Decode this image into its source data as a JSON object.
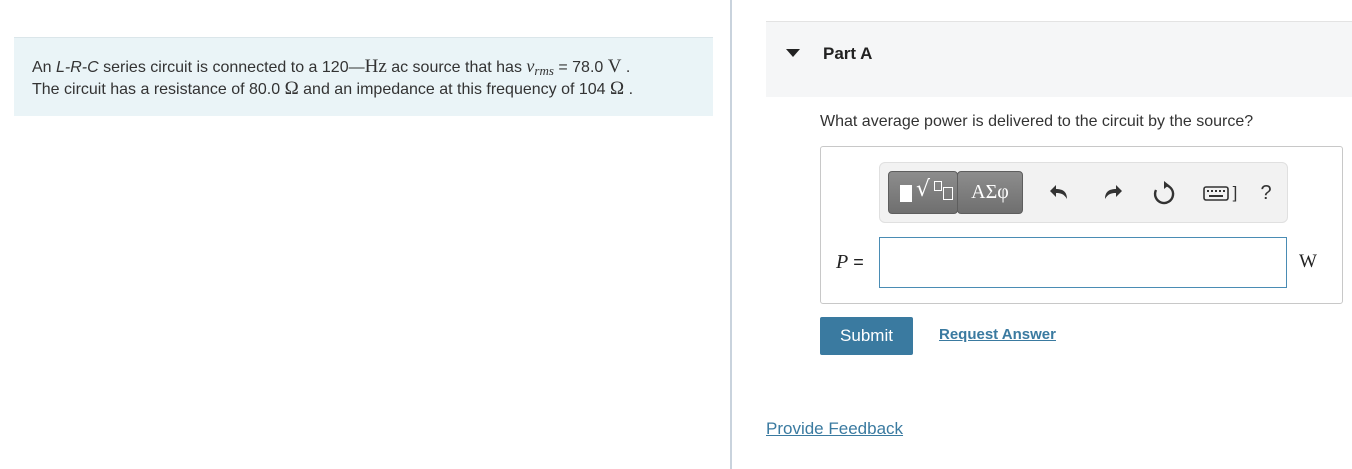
{
  "problem": {
    "line1_prefix": "An ",
    "circuit_type": "L-R-C",
    "line1_mid": " series circuit is connected to a 120",
    "dash": "—",
    "hz_unit": "Hz",
    "line1_mid2": " ac source that has ",
    "vrms_symbol": "v",
    "vrms_sub": "rms",
    "vrms_value": " = 78.0 ",
    "volt_unit": "V",
    "line1_end": " .",
    "line2_prefix": "The circuit has a resistance of 80.0 ",
    "ohm1": "Ω",
    "line2_mid": " and an impedance at this frequency of 104 ",
    "ohm2": "Ω",
    "line2_end": " ."
  },
  "part": {
    "title": "Part A",
    "question": "What average power is delivered to the circuit by the source?"
  },
  "toolbar": {
    "templates_icon": "templates-icon",
    "symbols_label": "ΑΣφ",
    "undo_icon": "undo-icon",
    "redo_icon": "redo-icon",
    "reset_icon": "reset-icon",
    "keyboard_icon": "keyboard-icon",
    "keyboard_bracket": "]",
    "help_label": "?"
  },
  "answer": {
    "variable": "P",
    "equals": " =",
    "value": "",
    "unit": "W"
  },
  "actions": {
    "submit_label": "Submit",
    "request_label": "Request Answer"
  },
  "footer": {
    "feedback_label": "Provide Feedback"
  }
}
